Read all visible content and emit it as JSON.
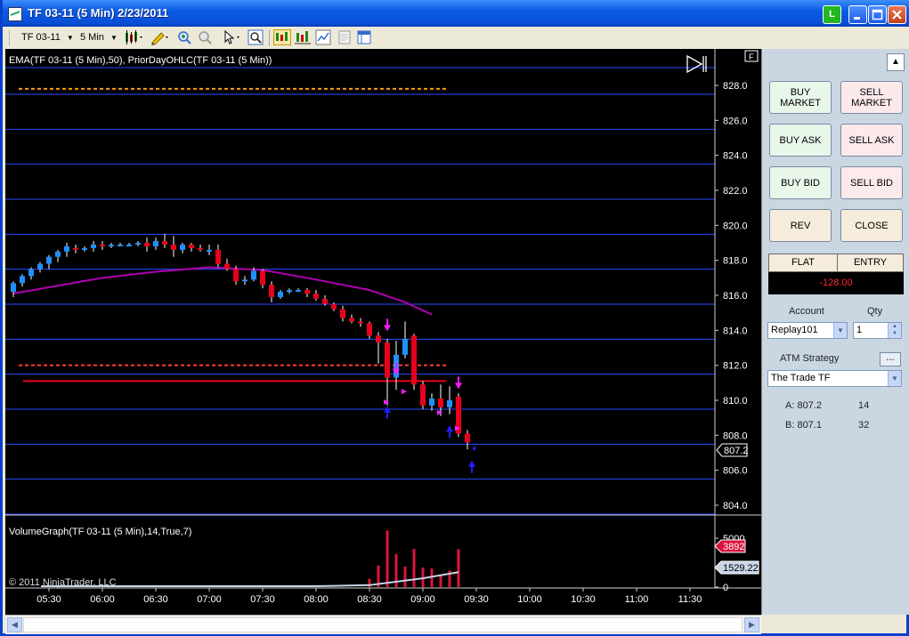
{
  "window": {
    "title": "TF 03-11 (5 Min)  2/23/2011",
    "link_button_label": "L"
  },
  "toolbar": {
    "instrument": "TF 03-11",
    "interval": "5 Min"
  },
  "chart": {
    "price_panel_label": "EMA(TF 03-11 (5 Min),50), PriorDayOHLC(TF 03-11 (5 Min))",
    "volume_panel_label": "VolumeGraph(TF 03-11 (5 Min),14,True,7)",
    "copyright": "© 2011 NinjaTrader, LLC",
    "panel_badge": "F",
    "price_axis": [
      "828.0",
      "826.0",
      "824.0",
      "822.0",
      "820.0",
      "818.0",
      "816.0",
      "814.0",
      "812.0",
      "810.0",
      "808.0",
      "806.0",
      "804.0"
    ],
    "current_price_tag": "807.2",
    "volume_axis": [
      "5000",
      "2000",
      "0"
    ],
    "volume_tag_red": "3892",
    "volume_tag_gray": "1529.22",
    "time_axis": [
      "05:30",
      "06:00",
      "06:30",
      "07:00",
      "07:30",
      "08:00",
      "08:30",
      "09:00",
      "09:30",
      "10:00",
      "10:30",
      "11:00",
      "11:30"
    ]
  },
  "chart_data": {
    "type": "candlestick",
    "ylim": [
      803.5,
      829.2
    ],
    "candles": [
      {
        "t": "05:10",
        "o": 816.2,
        "h": 816.8,
        "l": 815.9,
        "c": 816.7
      },
      {
        "t": "05:15",
        "o": 816.7,
        "h": 817.2,
        "l": 816.5,
        "c": 817.1
      },
      {
        "t": "05:20",
        "o": 817.1,
        "h": 817.6,
        "l": 816.9,
        "c": 817.5
      },
      {
        "t": "05:25",
        "o": 817.5,
        "h": 817.9,
        "l": 817.3,
        "c": 817.8
      },
      {
        "t": "05:30",
        "o": 817.8,
        "h": 818.3,
        "l": 817.5,
        "c": 818.2
      },
      {
        "t": "05:35",
        "o": 818.2,
        "h": 818.6,
        "l": 817.9,
        "c": 818.5
      },
      {
        "t": "05:40",
        "o": 818.5,
        "h": 819.0,
        "l": 818.2,
        "c": 818.8
      },
      {
        "t": "05:45",
        "o": 818.7,
        "h": 818.9,
        "l": 818.4,
        "c": 818.6
      },
      {
        "t": "05:50",
        "o": 818.6,
        "h": 818.8,
        "l": 818.5,
        "c": 818.7
      },
      {
        "t": "05:55",
        "o": 818.7,
        "h": 819.1,
        "l": 818.5,
        "c": 818.9
      },
      {
        "t": "06:00",
        "o": 818.9,
        "h": 819.1,
        "l": 818.6,
        "c": 818.8
      },
      {
        "t": "06:05",
        "o": 818.8,
        "h": 819.0,
        "l": 818.7,
        "c": 818.9
      },
      {
        "t": "06:10",
        "o": 818.9,
        "h": 819.0,
        "l": 818.8,
        "c": 818.9
      },
      {
        "t": "06:15",
        "o": 818.9,
        "h": 819.0,
        "l": 818.8,
        "c": 818.9
      },
      {
        "t": "06:20",
        "o": 818.9,
        "h": 819.1,
        "l": 818.8,
        "c": 819.0
      },
      {
        "t": "06:25",
        "o": 819.0,
        "h": 819.3,
        "l": 818.5,
        "c": 818.8
      },
      {
        "t": "06:30",
        "o": 818.8,
        "h": 819.3,
        "l": 818.6,
        "c": 819.1
      },
      {
        "t": "06:35",
        "o": 819.1,
        "h": 819.5,
        "l": 818.7,
        "c": 818.9
      },
      {
        "t": "06:40",
        "o": 818.9,
        "h": 819.4,
        "l": 818.2,
        "c": 818.6
      },
      {
        "t": "06:45",
        "o": 818.6,
        "h": 819.0,
        "l": 818.4,
        "c": 818.9
      },
      {
        "t": "06:50",
        "o": 818.9,
        "h": 819.0,
        "l": 818.5,
        "c": 818.7
      },
      {
        "t": "06:55",
        "o": 818.7,
        "h": 818.9,
        "l": 818.5,
        "c": 818.6
      },
      {
        "t": "07:00",
        "o": 818.6,
        "h": 818.9,
        "l": 818.3,
        "c": 818.6
      },
      {
        "t": "07:05",
        "o": 818.6,
        "h": 818.9,
        "l": 817.6,
        "c": 817.8
      },
      {
        "t": "07:10",
        "o": 817.8,
        "h": 818.1,
        "l": 817.4,
        "c": 817.5
      },
      {
        "t": "07:15",
        "o": 817.5,
        "h": 817.7,
        "l": 816.6,
        "c": 816.8
      },
      {
        "t": "07:20",
        "o": 816.8,
        "h": 817.1,
        "l": 816.6,
        "c": 816.9
      },
      {
        "t": "07:25",
        "o": 816.9,
        "h": 817.6,
        "l": 816.8,
        "c": 817.4
      },
      {
        "t": "07:30",
        "o": 817.4,
        "h": 817.5,
        "l": 816.4,
        "c": 816.6
      },
      {
        "t": "07:35",
        "o": 816.6,
        "h": 816.8,
        "l": 815.6,
        "c": 815.9
      },
      {
        "t": "07:40",
        "o": 815.9,
        "h": 816.3,
        "l": 815.8,
        "c": 816.2
      },
      {
        "t": "07:45",
        "o": 816.2,
        "h": 816.4,
        "l": 816.1,
        "c": 816.3
      },
      {
        "t": "07:50",
        "o": 816.3,
        "h": 816.4,
        "l": 816.2,
        "c": 816.3
      },
      {
        "t": "07:55",
        "o": 816.3,
        "h": 816.4,
        "l": 815.9,
        "c": 816.1
      },
      {
        "t": "08:00",
        "o": 816.1,
        "h": 816.3,
        "l": 815.7,
        "c": 815.8
      },
      {
        "t": "08:05",
        "o": 815.8,
        "h": 816.0,
        "l": 815.4,
        "c": 815.5
      },
      {
        "t": "08:10",
        "o": 815.5,
        "h": 815.6,
        "l": 815.1,
        "c": 815.2
      },
      {
        "t": "08:15",
        "o": 815.2,
        "h": 815.4,
        "l": 814.5,
        "c": 814.7
      },
      {
        "t": "08:20",
        "o": 814.7,
        "h": 814.9,
        "l": 814.4,
        "c": 814.5
      },
      {
        "t": "08:25",
        "o": 814.5,
        "h": 814.7,
        "l": 814.2,
        "c": 814.4
      },
      {
        "t": "08:30",
        "o": 814.4,
        "h": 814.5,
        "l": 813.5,
        "c": 813.7
      },
      {
        "t": "08:35",
        "o": 813.7,
        "h": 813.9,
        "l": 812.1,
        "c": 813.3
      },
      {
        "t": "08:40",
        "o": 813.3,
        "h": 813.5,
        "l": 809.7,
        "c": 811.3
      },
      {
        "t": "08:45",
        "o": 811.3,
        "h": 813.4,
        "l": 810.6,
        "c": 812.6
      },
      {
        "t": "08:50",
        "o": 812.6,
        "h": 814.5,
        "l": 812.4,
        "c": 813.5
      },
      {
        "t": "08:55",
        "o": 813.7,
        "h": 813.8,
        "l": 810.6,
        "c": 810.9
      },
      {
        "t": "09:00",
        "o": 810.9,
        "h": 811.1,
        "l": 809.5,
        "c": 809.7
      },
      {
        "t": "09:05",
        "o": 809.7,
        "h": 810.4,
        "l": 809.4,
        "c": 810.1
      },
      {
        "t": "09:10",
        "o": 810.1,
        "h": 810.9,
        "l": 809.1,
        "c": 809.6
      },
      {
        "t": "09:15",
        "o": 809.6,
        "h": 810.8,
        "l": 809.2,
        "c": 810.0
      },
      {
        "t": "09:20",
        "o": 810.2,
        "h": 810.4,
        "l": 807.9,
        "c": 808.1
      },
      {
        "t": "09:25",
        "o": 808.1,
        "h": 808.3,
        "l": 807.2,
        "c": 807.6
      }
    ],
    "ema_50": [
      {
        "t": "05:10",
        "v": 816.1
      },
      {
        "t": "06:00",
        "v": 817.0
      },
      {
        "t": "06:30",
        "v": 817.35
      },
      {
        "t": "07:00",
        "v": 817.6
      },
      {
        "t": "07:30",
        "v": 817.45
      },
      {
        "t": "08:00",
        "v": 816.9
      },
      {
        "t": "08:30",
        "v": 816.3
      },
      {
        "t": "08:50",
        "v": 815.6
      },
      {
        "t": "09:05",
        "v": 814.9
      }
    ],
    "prior_day_high": 827.8,
    "prior_day_low": 812.0,
    "prior_day_close": 811.1,
    "bid": 807.2,
    "ask": 807.1,
    "volume": [
      {
        "t": "08:30",
        "v": 850
      },
      {
        "t": "08:35",
        "v": 2200
      },
      {
        "t": "08:40",
        "v": 5800
      },
      {
        "t": "08:45",
        "v": 3400
      },
      {
        "t": "08:50",
        "v": 2100
      },
      {
        "t": "08:55",
        "v": 3900
      },
      {
        "t": "09:00",
        "v": 2000
      },
      {
        "t": "09:05",
        "v": 1900
      },
      {
        "t": "09:10",
        "v": 1200
      },
      {
        "t": "09:15",
        "v": 1700
      },
      {
        "t": "09:20",
        "v": 3892
      }
    ],
    "volume_avg_end": 1529.22,
    "volume_ylim": [
      0,
      6200
    ]
  },
  "order_panel": {
    "buy_market": "BUY\nMARKET",
    "sell_market": "SELL\nMARKET",
    "buy_ask": "BUY ASK",
    "sell_ask": "SELL ASK",
    "buy_bid": "BUY BID",
    "sell_bid": "SELL BID",
    "rev": "REV",
    "close": "CLOSE",
    "position_label": "FLAT",
    "entry_label": "ENTRY",
    "pnl": "-128.00",
    "account_label": "Account",
    "qty_label": "Qty",
    "account_value": "Replay101",
    "qty_value": "1",
    "atm_label": "ATM Strategy",
    "atm_button": "...",
    "atm_value": "The Trade TF",
    "ask_line_label": "A: 807.2",
    "ask_line_size": "14",
    "bid_line_label": "B: 807.1",
    "bid_line_size": "32"
  },
  "colors": {
    "up_candle": "#1e90ff",
    "down_candle": "#e8001c",
    "ema": "#b000b0",
    "grid": "#2a4cff",
    "prior_high": "#ff9a1a",
    "prior_low": "#ff3b3b",
    "volume": "#dc143c"
  }
}
